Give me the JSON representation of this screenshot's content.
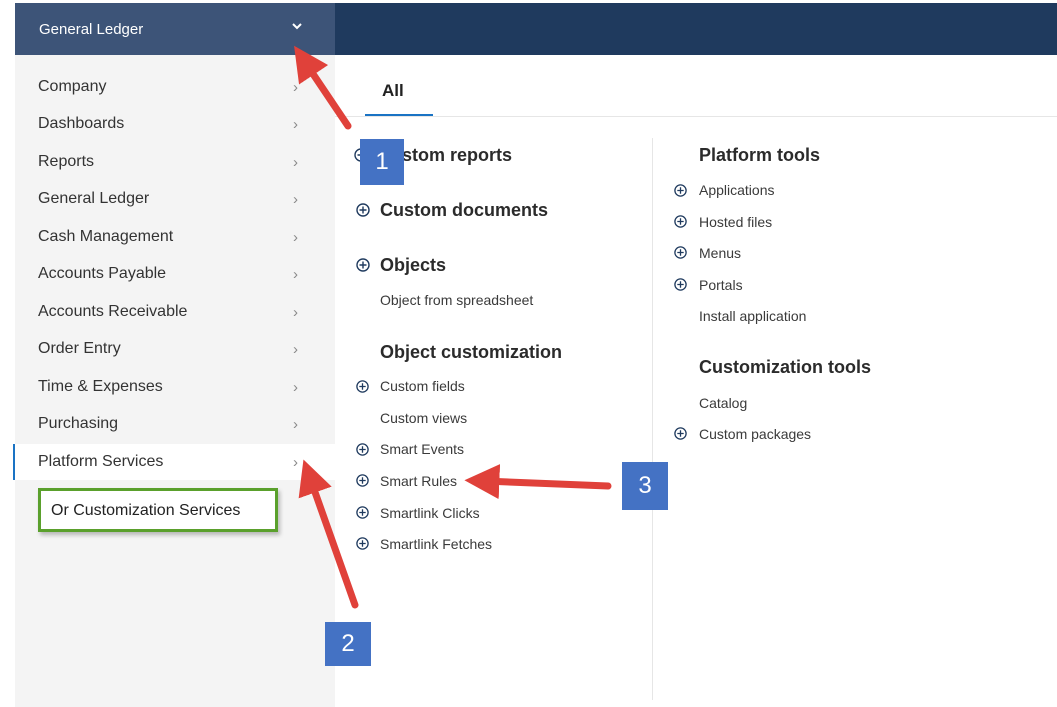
{
  "header": {
    "module_title": "General Ledger",
    "chevron_icon": "chevron-down-icon"
  },
  "sidebar": {
    "items": [
      {
        "label": "Company"
      },
      {
        "label": "Dashboards"
      },
      {
        "label": "Reports"
      },
      {
        "label": "General Ledger"
      },
      {
        "label": "Cash Management"
      },
      {
        "label": "Accounts Payable"
      },
      {
        "label": "Accounts Receivable"
      },
      {
        "label": "Order Entry"
      },
      {
        "label": "Time & Expenses"
      },
      {
        "label": "Purchasing"
      },
      {
        "label": "Platform Services"
      }
    ],
    "arrow_glyph": "›",
    "callout": "Or Customization Services"
  },
  "tabs": {
    "all": "All"
  },
  "left_col": {
    "custom_reports": "stom reports",
    "custom_documents": "Custom documents",
    "objects": "Objects",
    "object_from_spreadsheet": "Object from spreadsheet",
    "object_customization": "Object customization",
    "custom_fields": "Custom fields",
    "custom_views": "Custom views",
    "smart_events": "Smart Events",
    "smart_rules": "Smart Rules",
    "smartlink_clicks": "Smartlink Clicks",
    "smartlink_fetches": "Smartlink Fetches"
  },
  "right_col": {
    "platform_tools": "Platform tools",
    "applications": "Applications",
    "hosted_files": "Hosted files",
    "menus": "Menus",
    "portals": "Portals",
    "install_application": "Install application",
    "customization_tools": "Customization tools",
    "catalog": "Catalog",
    "custom_packages": "Custom packages"
  },
  "annotations": {
    "badge1": "1",
    "badge2": "2",
    "badge3": "3"
  },
  "colors": {
    "topbar_left": "#3d5478",
    "topbar_right": "#1f3a5e",
    "accent": "#1a73c4",
    "badge": "#4472c4",
    "arrow": "#e0413a",
    "callout_border": "#5aa02c"
  }
}
